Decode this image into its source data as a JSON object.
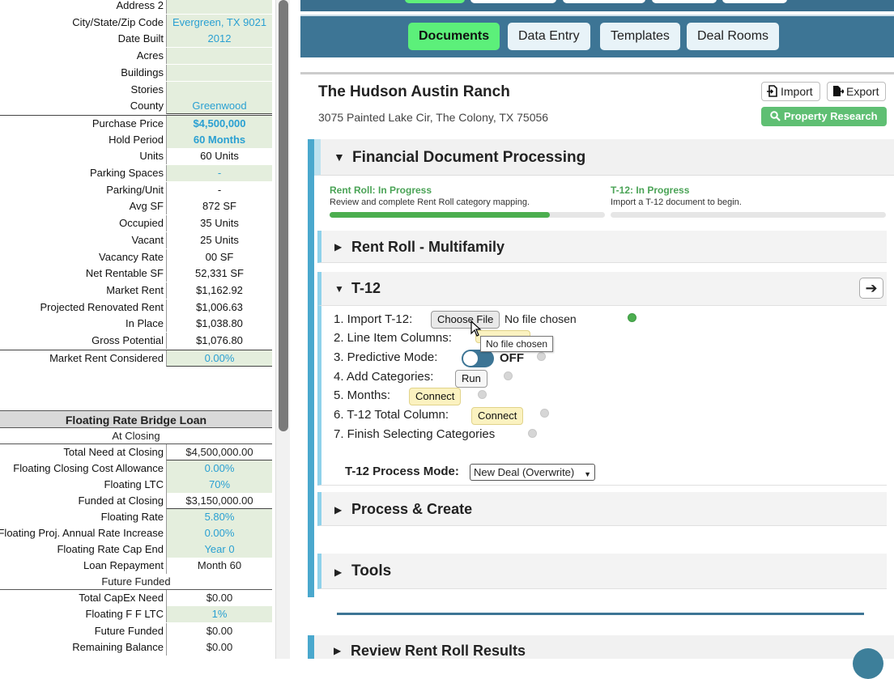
{
  "left": {
    "rows_top": [
      {
        "label": "Address 2",
        "value": ""
      },
      {
        "label": "City/State/Zip Code",
        "value": "Evergreen, TX 9021"
      },
      {
        "label": "Date Built",
        "value": "2012"
      },
      {
        "label": "Acres",
        "value": ""
      },
      {
        "label": "Buildings",
        "value": ""
      },
      {
        "label": "Stories",
        "value": ""
      },
      {
        "label": "County",
        "value": "Greenwood"
      },
      {
        "label": "Purchase Price",
        "value": "$4,500,000"
      },
      {
        "label": "Hold Period",
        "value": "60 Months"
      },
      {
        "label": "Units",
        "value": "60 Units"
      },
      {
        "label": "Parking Spaces",
        "value": "-"
      },
      {
        "label": "Parking/Unit",
        "value": "-"
      },
      {
        "label": "Avg SF",
        "value": "872 SF"
      },
      {
        "label": "Occupied",
        "value": "35 Units"
      },
      {
        "label": "Vacant",
        "value": "25 Units"
      },
      {
        "label": "Vacancy Rate",
        "value": "00 SF"
      },
      {
        "label": "Net Rentable SF",
        "value": "52,331 SF"
      },
      {
        "label": "Market Rent",
        "value": "$1,162.92"
      },
      {
        "label": "Projected Renovated Rent",
        "value": "$1,006.63"
      },
      {
        "label": "In Place",
        "value": "$1,038.80"
      },
      {
        "label": "Gross Potential",
        "value": "$1,076.80"
      },
      {
        "label": "Market Rent Considered",
        "value": "0.00%"
      }
    ],
    "loan_title": "Floating Rate Bridge Loan",
    "at_closing_title": "At Closing",
    "rows_closing": [
      {
        "label": "Total Need at Closing",
        "value": "$4,500,000.00"
      },
      {
        "label": "Floating Closing Cost Allowance",
        "value": "0.00%"
      },
      {
        "label": "Floating LTC",
        "value": "70%"
      },
      {
        "label": "Funded at Closing",
        "value": "$3,150,000.00"
      },
      {
        "label": "Floating Rate",
        "value": "5.80%"
      },
      {
        "label": "Floating Proj. Annual Rate Increase",
        "value": "0.00%"
      },
      {
        "label": "Floating Rate Cap End",
        "value": "Year 0"
      },
      {
        "label": "Loan Repayment",
        "value": "Month 60"
      }
    ],
    "future_funded_title": "Future Funded",
    "rows_future": [
      {
        "label": "Total CapEx Need",
        "value": "$0.00"
      },
      {
        "label": "Floating F F LTC",
        "value": "1%"
      },
      {
        "label": "Future Funded",
        "value": "$0.00"
      },
      {
        "label": "Remaining Balance",
        "value": "$0.00"
      }
    ]
  },
  "nav": {
    "tabs": [
      "Documents",
      "Data Entry",
      "Templates",
      "Deal Rooms"
    ],
    "active": 0
  },
  "property": {
    "title": "The Hudson Austin Ranch",
    "address": "3075 Painted Lake Cir, The Colony, TX 75056",
    "import_label": "Import",
    "export_label": "Export",
    "research_label": "Property Research"
  },
  "financial": {
    "title": "Financial Document Processing",
    "rent_roll_status": "Rent Roll: In Progress",
    "rent_roll_desc": "Review and complete Rent Roll category mapping.",
    "rent_roll_progress": 0.8,
    "t12_status": "T-12: In Progress",
    "t12_desc": "Import a T-12 document to begin.",
    "t12_progress": 0.0,
    "sections": {
      "rent_roll": "Rent Roll - Multifamily",
      "t12": "T-12",
      "process": "Process & Create",
      "tools": "Tools",
      "review": "Review Rent Roll Results"
    },
    "steps": {
      "s1": "1. Import T-12:",
      "s1_button": "Choose File",
      "s1_status": "No file chosen",
      "s2": "2. Line Item Columns:",
      "s3": "3. Predictive Mode:",
      "s3_toggle": "OFF",
      "s4": "4. Add Categories:",
      "s4_button": "Run",
      "s5": "5. Months:",
      "s5_button": "Connect",
      "s6": "6. T-12 Total Column:",
      "s6_button": "Connect",
      "s7": "7. Finish Selecting Categories"
    },
    "process_mode_label": "T-12 Process Mode:",
    "process_mode_value": "New Deal (Overwrite)",
    "tooltip": "No file chosen",
    "arrow": "➔"
  },
  "colors": {
    "nav_blue": "#3d7595",
    "active_green": "#5cf07a",
    "status_green": "#4aa356",
    "accent_blue": "#4aa8cd",
    "cell_green": "#e4eedd",
    "value_blue": "#2aa0d2"
  }
}
